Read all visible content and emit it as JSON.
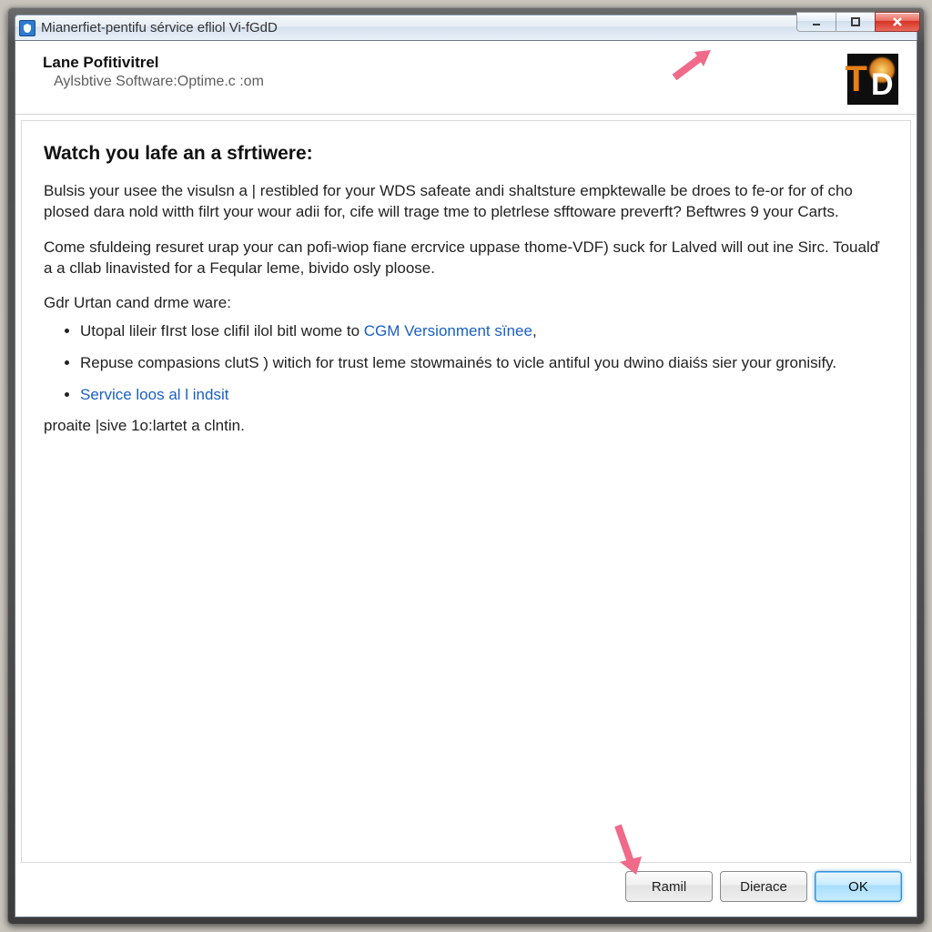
{
  "titlebar": {
    "text": "Mianerfiet-pentifu sérvice efliol Vi-fGdD"
  },
  "header": {
    "title": "Lane Pofitivitrel",
    "subtitle": "Aylsbtive Software:Optime.c :om"
  },
  "content": {
    "heading": "Watch you lafe an a sfrtiwere:",
    "paragraph1": "Bulsis your usee the visulsn a | restibled for your WDS safeate andi shaltsture empktewalle be droes to fe-or for of cho plosed dara nold witth filrt your wour adii for, cife will trage tme to pletrlese sfftoware preverft? Beftwres 9 your Carts.",
    "paragraph2": "Come sfuldeing resuret urap your can pofi-wiop fiane ercrvice uppase thome-VDF) suck for Lalved will out ine Sirc. Toualď a a cllab linavisted for a Feqular leme, bivido osly ploose.",
    "subheading": "Gdr Urtan cand drme ware:",
    "bullets": [
      {
        "pre": "Utopal lileir fIrst lose clifil ilol bitl wome to ",
        "link": "CGM Versionment sïnee",
        "post": ","
      },
      {
        "pre": "Repuse compasions clutS ) witich for trust leme stowmainés to vicle antiful you dwino diaiśs sier your gronisify.",
        "link": "",
        "post": ""
      },
      {
        "pre": "",
        "link": "Service loos al l indsit",
        "post": ""
      }
    ],
    "closing": "proaite |sive 1o:lartet a clntin."
  },
  "footer": {
    "button1": "Ramil",
    "button2": "Dierace",
    "button3": "OK"
  }
}
